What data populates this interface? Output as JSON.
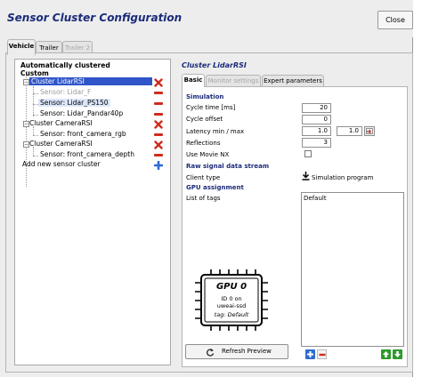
{
  "window": {
    "title": "Sensor Cluster Configuration",
    "close_label": "Close"
  },
  "tabs": [
    {
      "label": "Vehicle",
      "state": "active"
    },
    {
      "label": "Trailer",
      "state": "normal"
    },
    {
      "label": "Trailer 2",
      "state": "disabled"
    }
  ],
  "tree": {
    "root_auto": "Automatically clustered",
    "root_custom": "Custom",
    "items": [
      {
        "label": "Cluster LidarRSI",
        "kind": "cluster",
        "state": "selected"
      },
      {
        "label": "Sensor: Lidar_F",
        "kind": "sensor",
        "state": "dim"
      },
      {
        "label": "Sensor: Lidar_PS150",
        "kind": "sensor",
        "state": "highlight"
      },
      {
        "label": "Sensor: Lidar_Pandar40p",
        "kind": "sensor",
        "state": "normal"
      },
      {
        "label": "Cluster CameraRSI",
        "kind": "cluster",
        "state": "normal"
      },
      {
        "label": "Sensor: front_camera_rgb",
        "kind": "sensor",
        "state": "normal"
      },
      {
        "label": "Cluster CameraRSI",
        "kind": "cluster",
        "state": "normal"
      },
      {
        "label": "Sensor: front_camera_depth",
        "kind": "sensor",
        "state": "normal"
      }
    ],
    "add_label": "Add new sensor cluster"
  },
  "detail": {
    "title": "Cluster LidarRSI",
    "subtabs": [
      {
        "label": "Basic",
        "state": "active"
      },
      {
        "label": "Monitor settings",
        "state": "disabled"
      },
      {
        "label": "Expert parameters",
        "state": "normal"
      }
    ],
    "simulation": {
      "section": "Simulation",
      "cycle_time_label": "Cycle time [ms]",
      "cycle_time": "20",
      "cycle_offset_label": "Cycle offset",
      "cycle_offset": "0",
      "latency_label": "Latency min / max",
      "latency_min": "1.0",
      "latency_max": "1.0",
      "reflections_label": "Reflections",
      "reflections": "3",
      "movie_nx_label": "Use Movie NX",
      "movie_nx_checked": false
    },
    "raw": {
      "section": "Raw signal data stream",
      "client_type_label": "Client type",
      "client_type_value": "Simulation program"
    },
    "gpu": {
      "section": "GPU assignment",
      "tags_label": "List of tags",
      "tags": [
        "Default"
      ],
      "chip_title": "GPU 0",
      "chip_id": "ID 0 on",
      "chip_host": "uweai-ssd",
      "chip_tag": "tag: Default"
    },
    "refresh_label": "Refresh Preview"
  },
  "colors": {
    "accent": "#1b2a7a",
    "selection": "#2f55c9",
    "delete": "#d12b1f",
    "add": "#2f6bd0",
    "move": "#2e9a2e"
  }
}
